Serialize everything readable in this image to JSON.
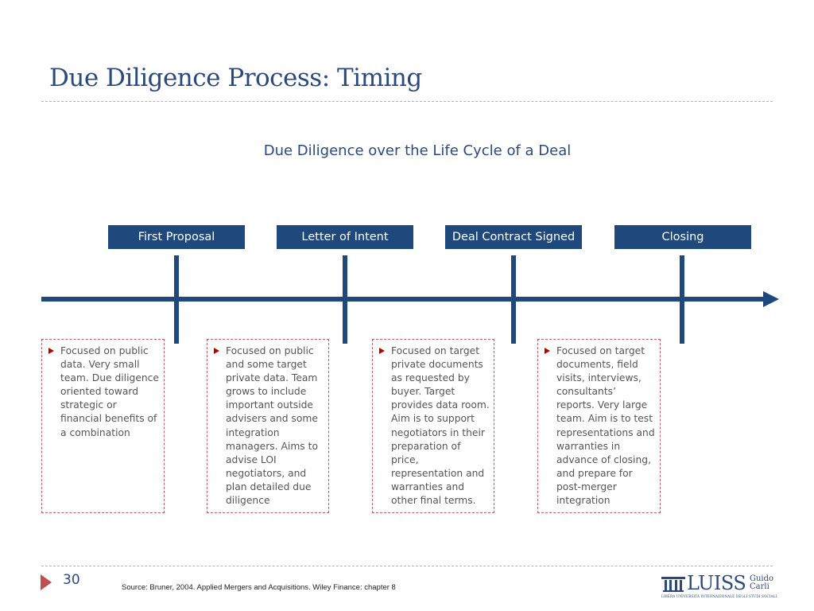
{
  "slide": {
    "title": "Due Diligence Process: Timing",
    "subtitle": "Due Diligence over the Life Cycle of a Deal",
    "page_number": "30",
    "source": "Source: Bruner, 2004. Applied Mergers and Acquisitions. Wiley Finance: chapter 8"
  },
  "timeline": {
    "stages": [
      {
        "label": "First Proposal",
        "description": "Focused on public data. Very small team. Due diligence oriented toward strategic or financial benefits of a combination"
      },
      {
        "label": "Letter of Intent",
        "description": "Focused on public and some target private data. Team grows to include important outside advisers and some integration managers. Aims to advise LOI negotiators, and plan detailed due diligence"
      },
      {
        "label": "Deal Contract Signed",
        "description": "Focused on target private documents as requested by buyer. Target provides data room. Aim is to support negotiators in their preparation of price, representation and warranties and other final terms."
      },
      {
        "label": "Closing",
        "description": "Focused on target documents, field visits, interviews, consultants’ reports. Very large team. Aim is to test representations and warranties in advance of closing, and prepare for post-merger integration"
      }
    ]
  },
  "logo": {
    "name": "LUISS",
    "sub_line1": "Guido",
    "sub_line2": "Carli",
    "tagline": "LIBERA UNIVERSITÀ INTERNAZIONALE DEGLI STUDI SOCIALI"
  },
  "colors": {
    "primary": "#1f497d",
    "title": "#2a4a7f",
    "accent_red": "#c00000",
    "dashed_border": "#c55a6a"
  }
}
